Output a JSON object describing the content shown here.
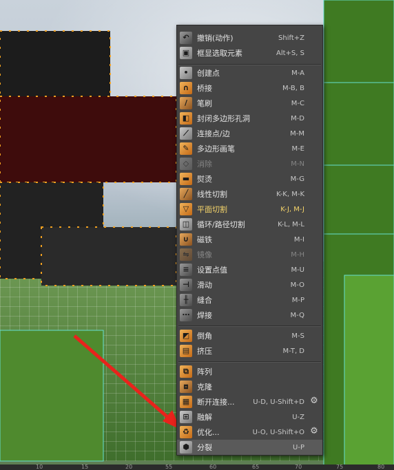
{
  "menu": {
    "items": [
      {
        "label": "撤销(动作)",
        "shortcut": "Shift+Z",
        "icon": "undo-icon"
      },
      {
        "label": "框显选取元素",
        "shortcut": "Alt+S, S",
        "icon": "frame-selection-icon"
      },
      {
        "label": "创建点",
        "shortcut": "M-A",
        "icon": "create-point-icon"
      },
      {
        "label": "桥接",
        "shortcut": "M-B, B",
        "icon": "bridge-icon"
      },
      {
        "label": "笔刷",
        "shortcut": "M-C",
        "icon": "brush-icon"
      },
      {
        "label": "封闭多边形孔洞",
        "shortcut": "M-D",
        "icon": "close-polygon-hole-icon"
      },
      {
        "label": "连接点/边",
        "shortcut": "M-M",
        "icon": "connect-points-edges-icon"
      },
      {
        "label": "多边形画笔",
        "shortcut": "M-E",
        "icon": "polygon-pen-icon"
      },
      {
        "label": "消除",
        "shortcut": "M-N",
        "icon": "dissolve-icon",
        "disabled": true
      },
      {
        "label": "熨烫",
        "shortcut": "M-G",
        "icon": "iron-icon"
      },
      {
        "label": "线性切割",
        "shortcut": "K-K, M-K",
        "icon": "line-cut-icon"
      },
      {
        "label": "平面切割",
        "shortcut": "K-J, M-J",
        "icon": "plane-cut-icon",
        "highlight": true
      },
      {
        "label": "循环/路径切割",
        "shortcut": "K-L, M-L",
        "icon": "loop-path-cut-icon"
      },
      {
        "label": "磁铁",
        "shortcut": "M-I",
        "icon": "magnet-icon"
      },
      {
        "label": "镜像",
        "shortcut": "M-H",
        "icon": "mirror-icon",
        "disabled": true
      },
      {
        "label": "设置点值",
        "shortcut": "M-U",
        "icon": "set-point-value-icon"
      },
      {
        "label": "滑动",
        "shortcut": "M-O",
        "icon": "slide-icon"
      },
      {
        "label": "缝合",
        "shortcut": "M-P",
        "icon": "stitch-icon"
      },
      {
        "label": "焊接",
        "shortcut": "M-Q",
        "icon": "weld-icon"
      },
      {
        "label": "倒角",
        "shortcut": "M-S",
        "icon": "bevel-icon"
      },
      {
        "label": "挤压",
        "shortcut": "M-T, D",
        "icon": "extrude-icon"
      },
      {
        "label": "阵列",
        "shortcut": "",
        "icon": "array-icon"
      },
      {
        "label": "克隆",
        "shortcut": "",
        "icon": "clone-icon"
      },
      {
        "label": "断开连接...",
        "shortcut": "U-D, U-Shift+D",
        "icon": "disconnect-icon",
        "gear": true
      },
      {
        "label": "融解",
        "shortcut": "U-Z",
        "icon": "melt-icon"
      },
      {
        "label": "优化...",
        "shortcut": "U-O, U-Shift+O",
        "icon": "optimize-icon",
        "gear": true
      },
      {
        "label": "分裂",
        "shortcut": "U-P",
        "icon": "split-icon",
        "selected": true
      }
    ]
  },
  "ruler": {
    "ticks": [
      "10",
      "15",
      "20",
      "55",
      "60",
      "65",
      "70",
      "75",
      "80"
    ]
  }
}
